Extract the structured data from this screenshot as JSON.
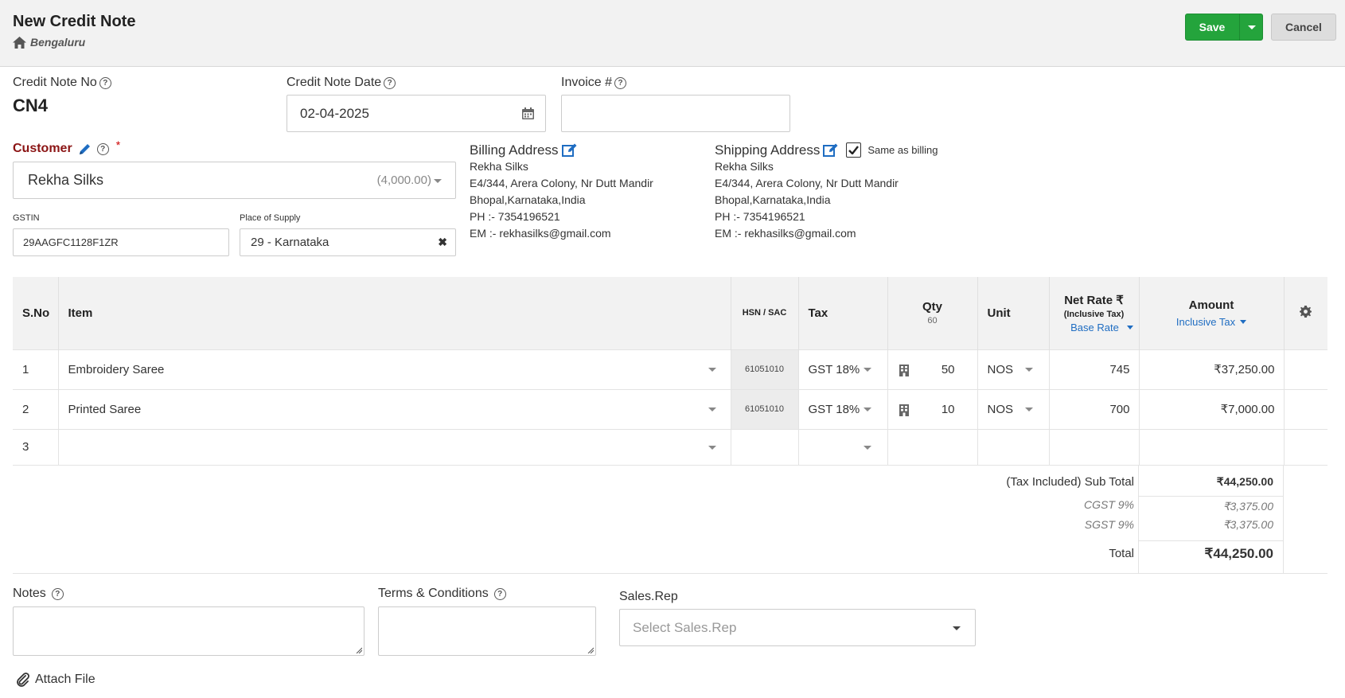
{
  "header": {
    "title": "New Credit Note",
    "branch": "Bengaluru",
    "save_label": "Save",
    "cancel_label": "Cancel"
  },
  "form": {
    "credit_note_no_label": "Credit Note No",
    "credit_note_no": "CN4",
    "credit_note_date_label": "Credit Note Date",
    "credit_note_date": "02-04-2025",
    "invoice_label": "Invoice #",
    "invoice_value": "",
    "customer_label": "Customer",
    "required_mark": "*",
    "customer_name": "Rekha Silks",
    "customer_balance": "(4,000.00)",
    "gstin_label": "GSTIN",
    "gstin": "29AAGFC1128F1ZR",
    "place_of_supply_label": "Place of Supply",
    "place_of_supply": "29 - Karnataka"
  },
  "billing": {
    "title": "Billing Address",
    "lines": [
      "Rekha Silks",
      "E4/344, Arera Colony, Nr Dutt Mandir",
      "Bhopal,Karnataka,India",
      "PH :- 7354196521",
      "EM :- rekhasilks@gmail.com"
    ]
  },
  "shipping": {
    "title": "Shipping Address",
    "same_as_billing": "Same as billing",
    "lines": [
      "Rekha Silks",
      "E4/344, Arera Colony, Nr Dutt Mandir",
      "Bhopal,Karnataka,India",
      "PH :- 7354196521",
      "EM :- rekhasilks@gmail.com"
    ]
  },
  "table": {
    "headers": {
      "sno": "S.No",
      "item": "Item",
      "hsn": "HSN / SAC",
      "tax": "Tax",
      "qty": "Qty",
      "qty_total": "60",
      "unit": "Unit",
      "net_rate": "Net Rate ₹",
      "net_rate_sub": "(Inclusive Tax)",
      "base_rate": "Base Rate",
      "amount": "Amount",
      "inclusive_tax": "Inclusive Tax"
    },
    "rows": [
      {
        "sno": "1",
        "item": "Embroidery Saree",
        "hsn": "61051010",
        "tax": "GST 18%",
        "qty": "50",
        "unit": "NOS",
        "rate": "745",
        "amount": "₹37,250.00"
      },
      {
        "sno": "2",
        "item": "Printed Saree",
        "hsn": "61051010",
        "tax": "GST 18%",
        "qty": "10",
        "unit": "NOS",
        "rate": "700",
        "amount": "₹7,000.00"
      },
      {
        "sno": "3",
        "item": "",
        "hsn": "",
        "tax": "",
        "qty": "",
        "unit": "",
        "rate": "",
        "amount": ""
      }
    ]
  },
  "totals": {
    "subtotal_label": "(Tax Included) Sub Total",
    "subtotal": "₹44,250.00",
    "cgst_label": "CGST 9%",
    "cgst": "₹3,375.00",
    "sgst_label": "SGST 9%",
    "sgst": "₹3,375.00",
    "total_label": "Total",
    "total": "₹44,250.00"
  },
  "footer": {
    "notes_label": "Notes",
    "terms_label": "Terms & Conditions",
    "sales_rep_label": "Sales.Rep",
    "sales_rep_placeholder": "Select Sales.Rep",
    "attach_label": "Attach File"
  },
  "colors": {
    "save_green": "#24a43c",
    "customer_label": "#8b1414",
    "link_blue": "#1f6dc2"
  }
}
